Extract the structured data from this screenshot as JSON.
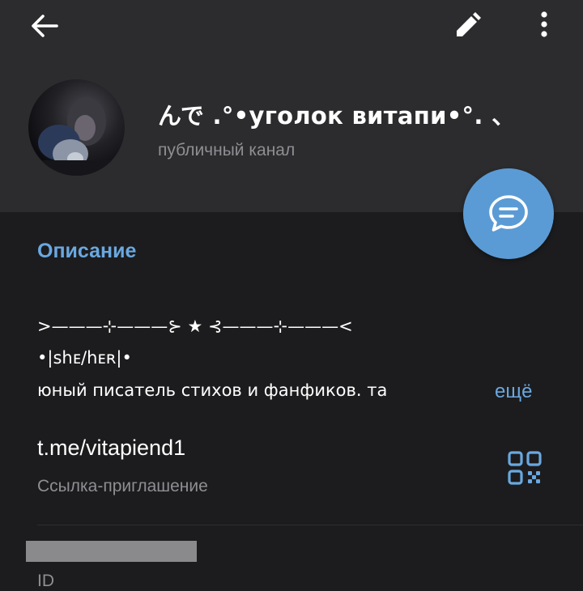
{
  "header": {
    "back_icon": "arrow-left-icon",
    "edit_icon": "pencil-icon",
    "more_icon": "more-vertical-icon"
  },
  "channel": {
    "title": "んで .°•уголок витапи•°. 、",
    "subtitle": "публичный канал",
    "avatar": "channel-avatar-photo"
  },
  "fab": {
    "icon": "chat-bubble-icon",
    "color": "#5b9bd5"
  },
  "description": {
    "heading": "Описание",
    "lines": [
      ">———⊹———⊱ ★ ⊰———⊹———<",
      "•|shᴇ/hᴇʀ|•",
      "юный писатель стихов и фанфиков. та"
    ],
    "more_label": "ещё"
  },
  "invite": {
    "link": "t.me/vitapiend1",
    "label": "Ссылка-приглашение",
    "qr_icon": "qr-code-icon"
  },
  "id_row": {
    "label": "ID"
  },
  "colors": {
    "accent": "#6aa8e0",
    "background": "#1c1c1e",
    "header": "#2c2c2e",
    "secondary_text": "#8e8e93"
  }
}
